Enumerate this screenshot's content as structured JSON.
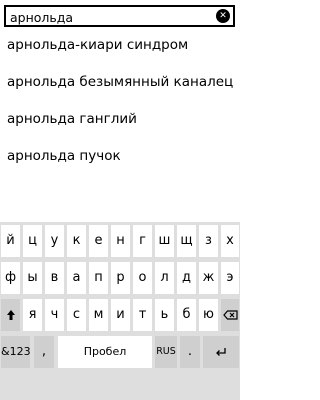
{
  "search": {
    "value": "арнольда",
    "clear_icon": "clear-x-icon"
  },
  "suggestions": [
    "арнольда-киари синдром",
    "арнольда безымянный каналец",
    "арнольда ганглий",
    "арнольда пучок"
  ],
  "keyboard": {
    "row1": [
      "й",
      "ц",
      "у",
      "к",
      "е",
      "н",
      "г",
      "ш",
      "щ",
      "з",
      "х"
    ],
    "row2": [
      "ф",
      "ы",
      "в",
      "а",
      "п",
      "р",
      "о",
      "л",
      "д",
      "ж",
      "э"
    ],
    "row3": [
      "я",
      "ч",
      "с",
      "м",
      "и",
      "т",
      "ь",
      "б",
      "ю"
    ],
    "shift_icon": "shift-arrow-icon",
    "backspace_icon": "backspace-icon",
    "symbols_label": "&123",
    "comma_label": ",",
    "space_label": "Пробел",
    "language_label": "RUS",
    "period_label": ".",
    "enter_icon": "enter-icon"
  },
  "colors": {
    "background": "#ffffff",
    "keyboard_bg": "#dedede",
    "key_bg": "#ffffff",
    "key_dark_bg": "#cfcfcf"
  }
}
